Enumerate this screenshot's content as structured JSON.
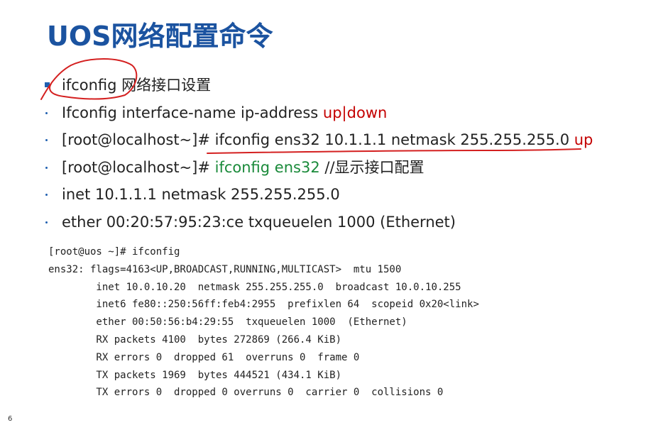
{
  "slide": {
    "title": "UOS网络配置命令",
    "page_number": "6"
  },
  "bullets": [
    {
      "parts": [
        {
          "text": "ifconfig 网络接口设置",
          "color": "default"
        }
      ]
    },
    {
      "parts": [
        {
          "text": "Ifconfig interface-name ip-address ",
          "color": "default"
        },
        {
          "text": "up|down",
          "color": "red"
        }
      ]
    },
    {
      "parts": [
        {
          "text": "[root@localhost~]# ifconfig ens32 10.1.1.1 netmask 255.255.255.0 ",
          "color": "default"
        },
        {
          "text": "up",
          "color": "red"
        }
      ]
    },
    {
      "parts": [
        {
          "text": "[root@localhost~]# ",
          "color": "default"
        },
        {
          "text": "ifconfig ens32",
          "color": "green"
        },
        {
          "text": "  //显示接口配置",
          "color": "default"
        }
      ]
    },
    {
      "parts": [
        {
          "text": "inet 10.1.1.1 netmask 255.255.255.0",
          "color": "default"
        }
      ]
    },
    {
      "parts": [
        {
          "text": "ether 00:20:57:95:23:ce txqueuelen 1000 (Ethernet)",
          "color": "default"
        }
      ]
    }
  ],
  "code_block": [
    "[root@uos ~]# ifconfig",
    "ens32: flags=4163<UP,BROADCAST,RUNNING,MULTICAST>  mtu 1500",
    "        inet 10.0.10.20  netmask 255.255.255.0  broadcast 10.0.10.255",
    "        inet6 fe80::250:56ff:feb4:2955  prefixlen 64  scopeid 0x20<link>",
    "        ether 00:50:56:b4:29:55  txqueuelen 1000  (Ethernet)",
    "        RX packets 4100  bytes 272869 (266.4 KiB)",
    "        RX errors 0  dropped 61  overruns 0  frame 0",
    "        TX packets 1969  bytes 444521 (434.1 KiB)",
    "        TX errors 0  dropped 0 overruns 0  carrier 0  collisions 0"
  ],
  "colors": {
    "title": "#1b53a0",
    "bullet_marker": "#1f5fb0",
    "red_text": "#c40000",
    "green_text": "#1a8a3a",
    "annotation_ink": "#d42020"
  }
}
